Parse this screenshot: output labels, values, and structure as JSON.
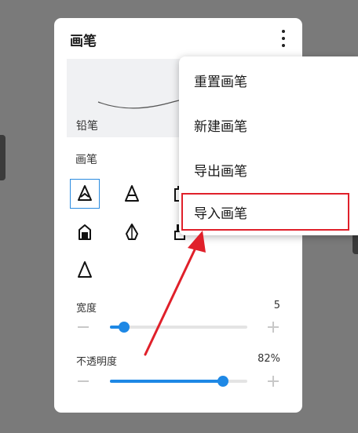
{
  "panel": {
    "title": "画笔",
    "more_icon": "more-vertical-icon",
    "preview_label": "铅笔",
    "section_label": "画笔",
    "brushes": [
      {
        "icon": "pencil-brush-icon",
        "selected": true
      },
      {
        "icon": "cone-brush-icon",
        "selected": false
      },
      {
        "icon": "marker-brush-icon",
        "selected": false
      },
      {
        "icon": "house-brush-icon",
        "selected": false
      },
      {
        "icon": "nib-brush-icon",
        "selected": false
      },
      {
        "icon": "paint-brush-icon",
        "selected": false
      },
      {
        "icon": "triangle-brush-icon",
        "selected": false
      }
    ],
    "width_slider": {
      "label": "宽度",
      "value": "5",
      "level": 0.1
    },
    "opacity_slider": {
      "label": "不透明度",
      "value": "82%",
      "level": 0.82
    }
  },
  "menu": {
    "items": [
      "重置画笔",
      "新建画笔",
      "导出画笔",
      "导入画笔"
    ],
    "highlighted_index": 3
  },
  "colors": {
    "accent": "#1e88e5",
    "annotation": "#e0202a",
    "backdrop": "#7a7a7a"
  }
}
